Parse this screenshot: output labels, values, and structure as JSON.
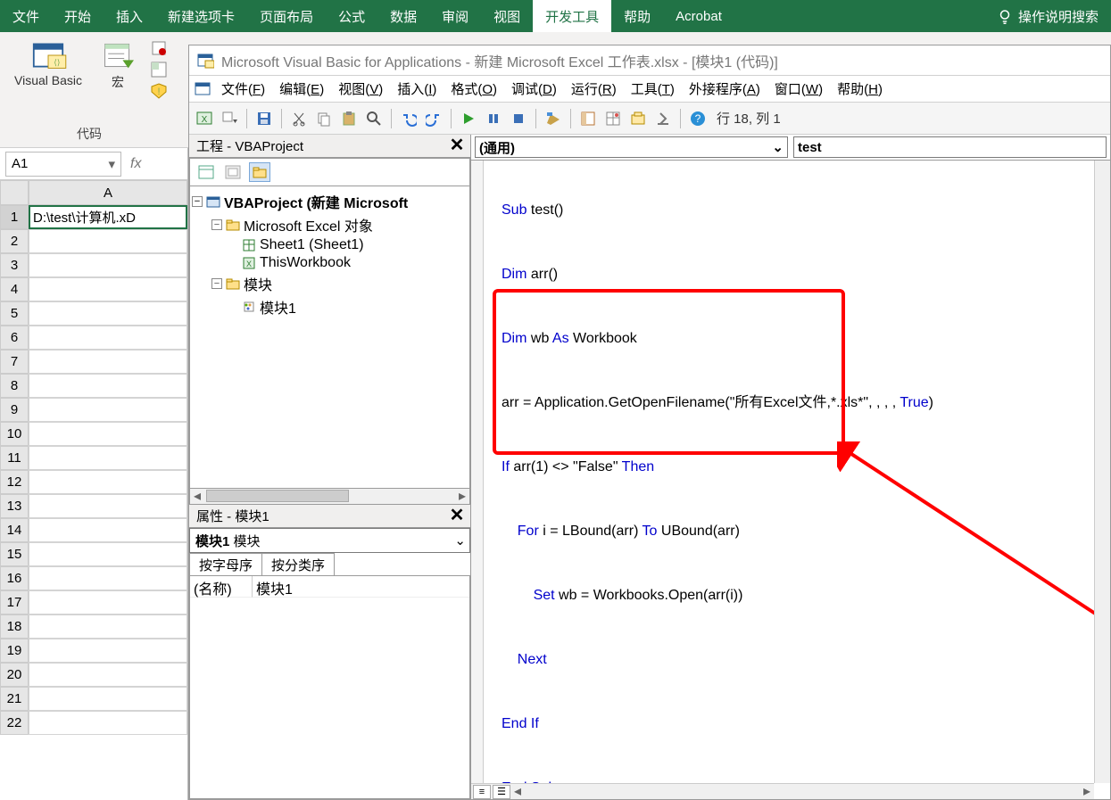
{
  "ribbon": {
    "tabs": [
      "文件",
      "开始",
      "插入",
      "新建选项卡",
      "页面布局",
      "公式",
      "数据",
      "审阅",
      "视图",
      "开发工具",
      "帮助",
      "Acrobat"
    ],
    "active_tab": "开发工具",
    "search_placeholder": "操作说明搜索",
    "group_code_label": "代码",
    "btn_visual_basic": "Visual Basic",
    "btn_macros": "宏"
  },
  "excel": {
    "name_box": "A1",
    "col_header": "A",
    "a1_value": "D:\\test\\计算机.xD",
    "row_count": 22
  },
  "vbe": {
    "title": "Microsoft Visual Basic for Applications - 新建 Microsoft Excel 工作表.xlsx - [模块1 (代码)]",
    "menus": [
      {
        "l": "文件",
        "k": "F"
      },
      {
        "l": "编辑",
        "k": "E"
      },
      {
        "l": "视图",
        "k": "V"
      },
      {
        "l": "插入",
        "k": "I"
      },
      {
        "l": "格式",
        "k": "O"
      },
      {
        "l": "调试",
        "k": "D"
      },
      {
        "l": "运行",
        "k": "R"
      },
      {
        "l": "工具",
        "k": "T"
      },
      {
        "l": "外接程序",
        "k": "A"
      },
      {
        "l": "窗口",
        "k": "W"
      },
      {
        "l": "帮助",
        "k": "H"
      }
    ],
    "cursor_pos": "行 18, 列 1",
    "project_panel_title": "工程 - VBAProject",
    "tree": {
      "root": "VBAProject (新建 Microsoft",
      "folder_objects": "Microsoft Excel 对象",
      "sheet1": "Sheet1 (Sheet1)",
      "thiswb": "ThisWorkbook",
      "folder_modules": "模块",
      "module1": "模块1"
    },
    "props_panel_title": "属性 - 模块1",
    "props_combo_bold": "模块1",
    "props_combo_rest": " 模块",
    "props_tab_alpha": "按字母序",
    "props_tab_cat": "按分类序",
    "props_name_key": "(名称)",
    "props_name_val": "模块1",
    "obj_selector": "(通用)",
    "proc_selector": "test",
    "code": {
      "l1": {
        "a": "Sub",
        "b": " test()"
      },
      "l2": {
        "a": "Dim",
        "b": " arr()"
      },
      "l3": {
        "a": "Dim",
        "b": " wb ",
        "c": "As",
        "d": " Workbook"
      },
      "l4": {
        "a": "arr = Application.GetOpenFilename(\"所有Excel文件,*.xls*\", , , , ",
        "b": "True",
        "c": ")"
      },
      "l5": {
        "a": "If",
        "b": " arr(1) <> \"False\" ",
        "c": "Then"
      },
      "l6": {
        "a": "    ",
        "b": "For",
        "c": " i = LBound(arr) ",
        "d": "To",
        "e": " UBound(arr)"
      },
      "l7": {
        "a": "        ",
        "b": "Set",
        "c": " wb = Workbooks.Open(arr(i))"
      },
      "l8": {
        "a": "    ",
        "b": "Next"
      },
      "l9": {
        "a": "End If"
      },
      "l10": {
        "a": "End Sub"
      }
    }
  }
}
